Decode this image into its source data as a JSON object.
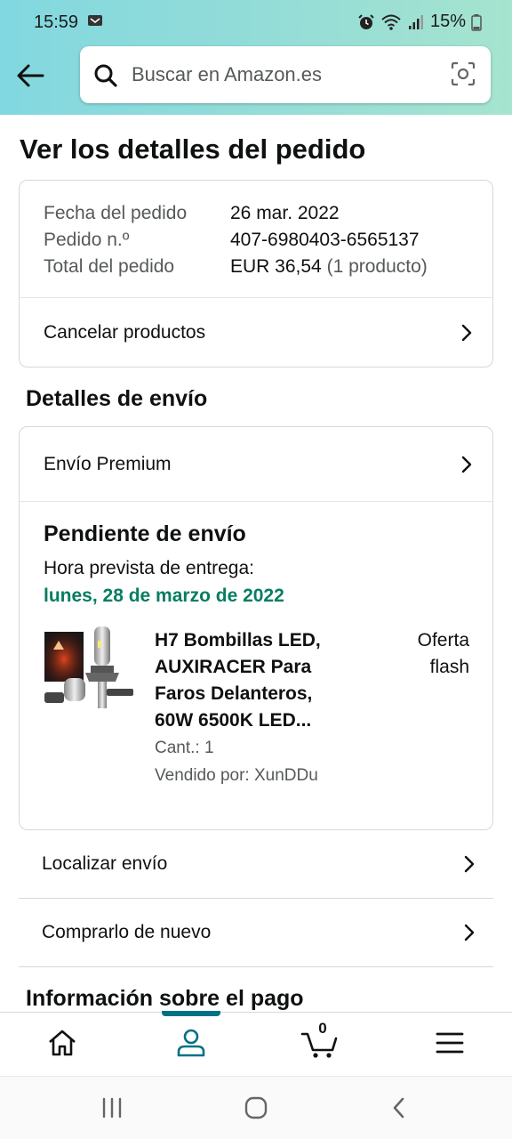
{
  "status_bar": {
    "time": "15:59",
    "battery": "15%"
  },
  "header": {
    "search_placeholder": "Buscar en Amazon.es"
  },
  "page": {
    "title": "Ver los detalles del pedido"
  },
  "order_summary": {
    "date_label": "Fecha del pedido",
    "date_value": "26 mar. 2022",
    "order_no_label": "Pedido n.º",
    "order_no_value": "407-6980403-6565137",
    "total_label": "Total del pedido",
    "total_value": "EUR 36,54",
    "total_count": "(1 producto)",
    "cancel_label": "Cancelar productos"
  },
  "shipping": {
    "section_title": "Detalles de envío",
    "method_label": "Envío Premium",
    "status_title": "Pendiente de envío",
    "eta_label": "Hora prevista de entrega:",
    "eta_date": "lunes, 28 de marzo de 2022",
    "product": {
      "title_line1": "H7 Bombillas LED,",
      "title_line2": "AUXIRACER Para",
      "title_line3": "Faros Delanteros,",
      "title_line4": "60W 6500K LED...",
      "badge_line1": "Oferta",
      "badge_line2": "flash",
      "qty": "Cant.: 1",
      "seller": "Vendido por: XunDDu"
    }
  },
  "actions": {
    "track": "Localizar envío",
    "buy_again": "Comprarlo de nuevo"
  },
  "payment": {
    "section_title": "Información sobre el pago"
  },
  "bottom_nav": {
    "cart_count": "0",
    "active_color": "#007185"
  },
  "colors": {
    "header_gradient_start": "#82d8e0",
    "header_gradient_end": "#a5e4cf",
    "delivery_green": "#067d62"
  }
}
